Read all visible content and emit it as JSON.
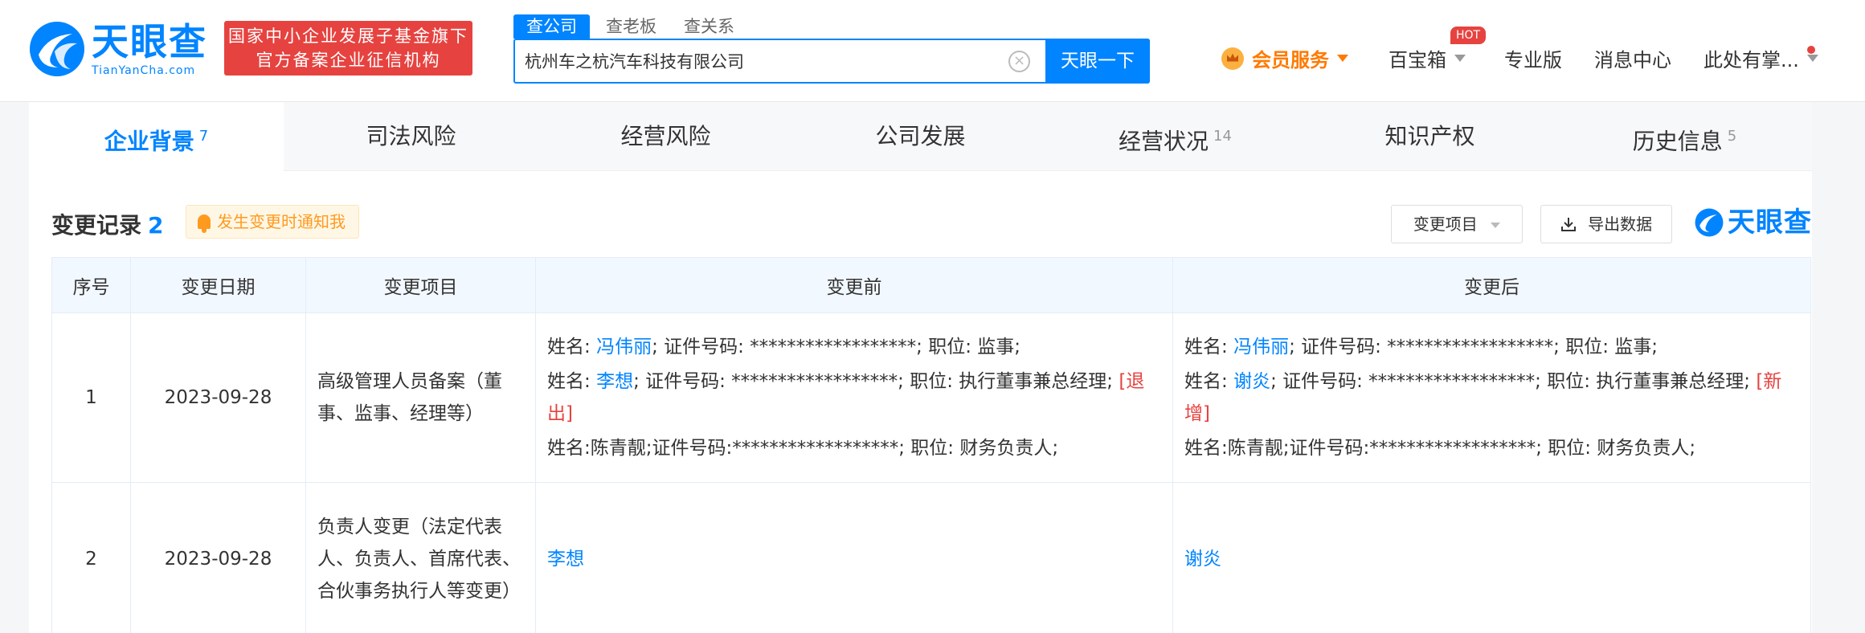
{
  "header": {
    "logo_cn": "天眼查",
    "logo_en": "TianYanCha.com",
    "org_line1": "国家中小企业发展子基金旗下",
    "org_line2": "官方备案企业征信机构",
    "search_tabs": [
      "查公司",
      "查老板",
      "查关系"
    ],
    "search_value": "杭州车之杭汽车科技有限公司",
    "search_button": "天眼一下",
    "nav": {
      "vip": "会员服务",
      "baoxiang": "百宝箱",
      "hot": "HOT",
      "pro": "专业版",
      "messages": "消息中心",
      "user": "此处有掌..."
    }
  },
  "tabs": [
    {
      "label": "企业背景",
      "count": "7"
    },
    {
      "label": "司法风险",
      "count": ""
    },
    {
      "label": "经营风险",
      "count": ""
    },
    {
      "label": "公司发展",
      "count": ""
    },
    {
      "label": "经营状况",
      "count": "14"
    },
    {
      "label": "知识产权",
      "count": ""
    },
    {
      "label": "历史信息",
      "count": "5"
    }
  ],
  "section": {
    "title": "变更记录",
    "count": "2",
    "notify": "发生变更时通知我",
    "filter": "变更项目",
    "export": "导出数据",
    "watermark": "天眼查"
  },
  "table": {
    "headers": [
      "序号",
      "变更日期",
      "变更项目",
      "变更前",
      "变更后"
    ],
    "rows": [
      {
        "no": "1",
        "date": "2023-09-28",
        "item": "高级管理人员备案（董事、监事、经理等）",
        "before": [
          {
            "pre": "姓名: ",
            "name": "冯伟丽",
            "post": "; 证件号码: ******************; 职位: 监事;",
            "tag": ""
          },
          {
            "pre": "姓名: ",
            "name": "李想",
            "post": "; 证件号码: ******************; 职位: 执行董事兼总经理; ",
            "tag": "[退出]"
          },
          {
            "pre": "姓名:陈青靓;证件号码:******************; 职位: 财务负责人;",
            "name": "",
            "post": "",
            "tag": ""
          }
        ],
        "after": [
          {
            "pre": "姓名: ",
            "name": "冯伟丽",
            "post": "; 证件号码: ******************; 职位: 监事;",
            "tag": ""
          },
          {
            "pre": "姓名: ",
            "name": "谢炎",
            "post": "; 证件号码: ******************; 职位: 执行董事兼总经理; ",
            "tag": "[新增]"
          },
          {
            "pre": "姓名:陈青靓;证件号码:******************; 职位: 财务负责人;",
            "name": "",
            "post": "",
            "tag": ""
          }
        ]
      },
      {
        "no": "2",
        "date": "2023-09-28",
        "item": "负责人变更（法定代表人、负责人、首席代表、合伙事务执行人等变更）",
        "before_name": "李想",
        "after_name": "谢炎"
      }
    ]
  }
}
